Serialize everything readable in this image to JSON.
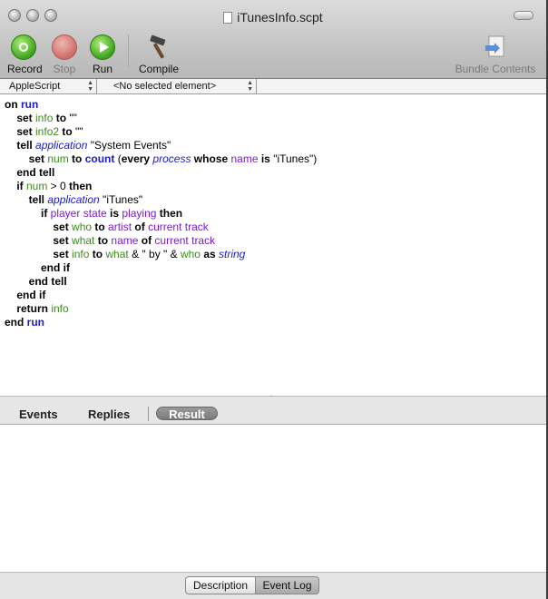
{
  "window": {
    "title": "iTunesInfo.scpt",
    "close_icon": "close-traffic-light",
    "minimize_icon": "minimize-traffic-light",
    "zoom_icon": "zoom-traffic-light"
  },
  "toolbar": {
    "record_label": "Record",
    "stop_label": "Stop",
    "run_label": "Run",
    "compile_label": "Compile",
    "bundle_label": "Bundle Contents",
    "icons": {
      "record": "record-icon",
      "stop": "stop-icon",
      "run": "play-icon",
      "compile": "hammer-icon",
      "bundle": "bundle-contents-icon"
    }
  },
  "popups": {
    "language": "AppleScript",
    "element": "<No selected element>"
  },
  "code": {
    "lines": [
      [
        {
          "t": "on ",
          "c": "kw"
        },
        {
          "t": "run",
          "c": "kb"
        }
      ],
      [
        {
          "t": "    set ",
          "c": "kw"
        },
        {
          "t": "info",
          "c": "var"
        },
        {
          "t": " to ",
          "c": "kw"
        },
        {
          "t": "\"\"",
          "c": ""
        }
      ],
      [
        {
          "t": "    set ",
          "c": "kw"
        },
        {
          "t": "info2",
          "c": "var"
        },
        {
          "t": " to ",
          "c": "kw"
        },
        {
          "t": "\"\"",
          "c": ""
        }
      ],
      [
        {
          "t": "    tell ",
          "c": "kw"
        },
        {
          "t": "application",
          "c": "cls"
        },
        {
          "t": " \"System Events\"",
          "c": ""
        }
      ],
      [
        {
          "t": "        set ",
          "c": "kw"
        },
        {
          "t": "num",
          "c": "var"
        },
        {
          "t": " to ",
          "c": "kw"
        },
        {
          "t": "count",
          "c": "cmd"
        },
        {
          "t": " (",
          "c": ""
        },
        {
          "t": "every ",
          "c": "kw"
        },
        {
          "t": "process",
          "c": "cls"
        },
        {
          "t": " whose ",
          "c": "kw"
        },
        {
          "t": "name",
          "c": "prop"
        },
        {
          "t": " is ",
          "c": "kw"
        },
        {
          "t": "\"iTunes\")",
          "c": ""
        }
      ],
      [
        {
          "t": "    end tell",
          "c": "kw"
        }
      ],
      [
        {
          "t": "    if ",
          "c": "kw"
        },
        {
          "t": "num",
          "c": "var"
        },
        {
          "t": " > 0 ",
          "c": ""
        },
        {
          "t": "then",
          "c": "kw"
        }
      ],
      [
        {
          "t": "        tell ",
          "c": "kw"
        },
        {
          "t": "application",
          "c": "cls"
        },
        {
          "t": " \"iTunes\"",
          "c": ""
        }
      ],
      [
        {
          "t": "            if ",
          "c": "kw"
        },
        {
          "t": "player state",
          "c": "prop"
        },
        {
          "t": " is ",
          "c": "kw"
        },
        {
          "t": "playing",
          "c": "prop"
        },
        {
          "t": " then",
          "c": "kw"
        }
      ],
      [
        {
          "t": "                set ",
          "c": "kw"
        },
        {
          "t": "who",
          "c": "var"
        },
        {
          "t": " to ",
          "c": "kw"
        },
        {
          "t": "artist",
          "c": "prop"
        },
        {
          "t": " of ",
          "c": "kw"
        },
        {
          "t": "current track",
          "c": "prop"
        }
      ],
      [
        {
          "t": "                set ",
          "c": "kw"
        },
        {
          "t": "what",
          "c": "var"
        },
        {
          "t": " to ",
          "c": "kw"
        },
        {
          "t": "name",
          "c": "prop"
        },
        {
          "t": " of ",
          "c": "kw"
        },
        {
          "t": "current track",
          "c": "prop"
        }
      ],
      [
        {
          "t": "                set ",
          "c": "kw"
        },
        {
          "t": "info",
          "c": "var"
        },
        {
          "t": " to ",
          "c": "kw"
        },
        {
          "t": "what",
          "c": "var"
        },
        {
          "t": " & \" by \" & ",
          "c": ""
        },
        {
          "t": "who",
          "c": "var"
        },
        {
          "t": " as ",
          "c": "kw"
        },
        {
          "t": "string",
          "c": "cls"
        }
      ],
      [
        {
          "t": "            end if",
          "c": "kw"
        }
      ],
      [
        {
          "t": "        end tell",
          "c": "kw"
        }
      ],
      [
        {
          "t": "    end if",
          "c": "kw"
        }
      ],
      [
        {
          "t": "    return ",
          "c": "kw"
        },
        {
          "t": "info",
          "c": "var"
        }
      ],
      [
        {
          "t": "end ",
          "c": "kw"
        },
        {
          "t": "run",
          "c": "kb"
        }
      ]
    ]
  },
  "result_tabs": {
    "events": "Events",
    "replies": "Replies",
    "result": "Result",
    "selected": "Result"
  },
  "bottom_tabs": {
    "description": "Description",
    "event_log": "Event Log",
    "selected": "Event Log"
  }
}
